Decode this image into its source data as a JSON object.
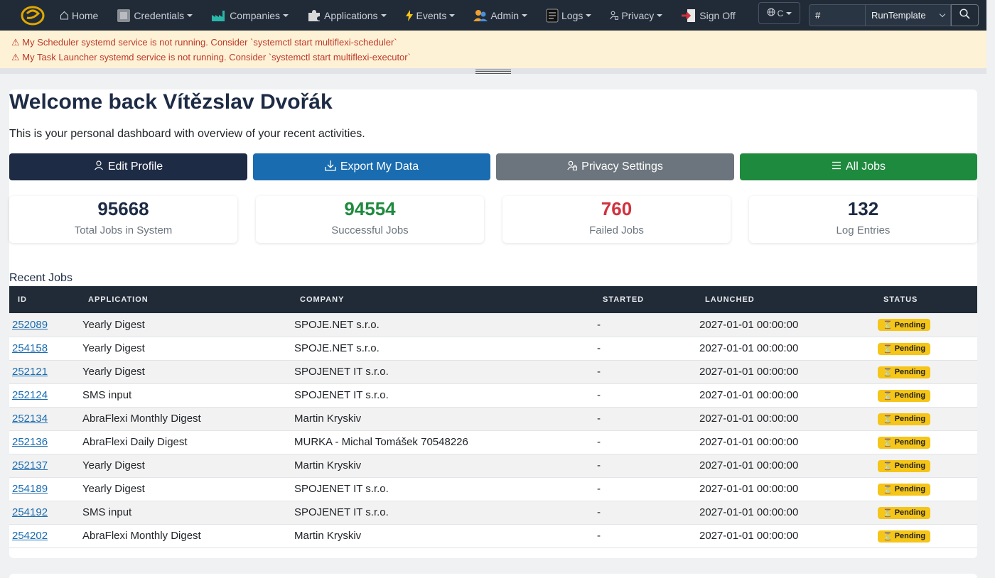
{
  "navbar": {
    "items": [
      {
        "label": "Home",
        "icon": "house-icon",
        "caret": false
      },
      {
        "label": "Credentials",
        "icon": "credentials-icon",
        "caret": true
      },
      {
        "label": "Companies",
        "icon": "factory-icon",
        "caret": true
      },
      {
        "label": "Applications",
        "icon": "puzzle-icon",
        "caret": true
      },
      {
        "label": "Events",
        "icon": "lightning-icon",
        "caret": true
      },
      {
        "label": "Admin",
        "icon": "admin-users-icon",
        "caret": true
      },
      {
        "label": "Logs",
        "icon": "log-file-icon",
        "caret": true
      },
      {
        "label": "Privacy",
        "icon": "privacy-lock-icon",
        "caret": true
      },
      {
        "label": "Sign Off",
        "icon": "sign-off-icon",
        "caret": false
      }
    ],
    "language": "C",
    "search_value": "#",
    "select_value": "RunTemplate"
  },
  "alerts": [
    "⚠ My Scheduler systemd service is not running. Consider `systemctl start multiflexi-scheduler`",
    "⚠ My Task Launcher systemd service is not running. Consider `systemctl start multiflexi-executor`"
  ],
  "welcome": {
    "title": "Welcome back Vítězslav Dvořák",
    "subtitle": "This is your personal dashboard with overview of your recent activities."
  },
  "actions": {
    "edit_profile": "Edit Profile",
    "export_data": "Export My Data",
    "privacy_settings": "Privacy Settings",
    "all_jobs": "All Jobs"
  },
  "stats": [
    {
      "value": "95668",
      "label": "Total Jobs in System",
      "color": "#1d2b45"
    },
    {
      "value": "94554",
      "label": "Successful Jobs",
      "color": "#1e8a3e"
    },
    {
      "value": "760",
      "label": "Failed Jobs",
      "color": "#d0323e"
    },
    {
      "value": "132",
      "label": "Log Entries",
      "color": "#1d2b45"
    }
  ],
  "recent_jobs": {
    "title": "Recent Jobs",
    "columns": [
      "ID",
      "APPLICATION",
      "COMPANY",
      "STARTED",
      "LAUNCHED",
      "STATUS"
    ],
    "rows": [
      {
        "id": "252089",
        "application": "Yearly Digest",
        "company": "SPOJE.NET s.r.o.",
        "started": "-",
        "launched": "2027-01-01 00:00:00",
        "status": "Pending"
      },
      {
        "id": "254158",
        "application": "Yearly Digest",
        "company": "SPOJE.NET s.r.o.",
        "started": "-",
        "launched": "2027-01-01 00:00:00",
        "status": "Pending"
      },
      {
        "id": "252121",
        "application": "Yearly Digest",
        "company": "SPOJENET IT s.r.o.",
        "started": "-",
        "launched": "2027-01-01 00:00:00",
        "status": "Pending"
      },
      {
        "id": "252124",
        "application": "SMS input",
        "company": "SPOJENET IT s.r.o.",
        "started": "-",
        "launched": "2027-01-01 00:00:00",
        "status": "Pending"
      },
      {
        "id": "252134",
        "application": "AbraFlexi Monthly Digest",
        "company": "Martin Kryskiv",
        "started": "-",
        "launched": "2027-01-01 00:00:00",
        "status": "Pending"
      },
      {
        "id": "252136",
        "application": "AbraFlexi Daily Digest",
        "company": "MURKA - Michal Tomášek 70548226",
        "started": "-",
        "launched": "2027-01-01 00:00:00",
        "status": "Pending"
      },
      {
        "id": "252137",
        "application": "Yearly Digest",
        "company": "Martin Kryskiv",
        "started": "-",
        "launched": "2027-01-01 00:00:00",
        "status": "Pending"
      },
      {
        "id": "254189",
        "application": "Yearly Digest",
        "company": "SPOJENET IT s.r.o.",
        "started": "-",
        "launched": "2027-01-01 00:00:00",
        "status": "Pending"
      },
      {
        "id": "254192",
        "application": "SMS input",
        "company": "SPOJENET IT s.r.o.",
        "started": "-",
        "launched": "2027-01-01 00:00:00",
        "status": "Pending"
      },
      {
        "id": "254202",
        "application": "AbraFlexi Monthly Digest",
        "company": "Martin Kryskiv",
        "started": "-",
        "launched": "2027-01-01 00:00:00",
        "status": "Pending"
      }
    ]
  }
}
